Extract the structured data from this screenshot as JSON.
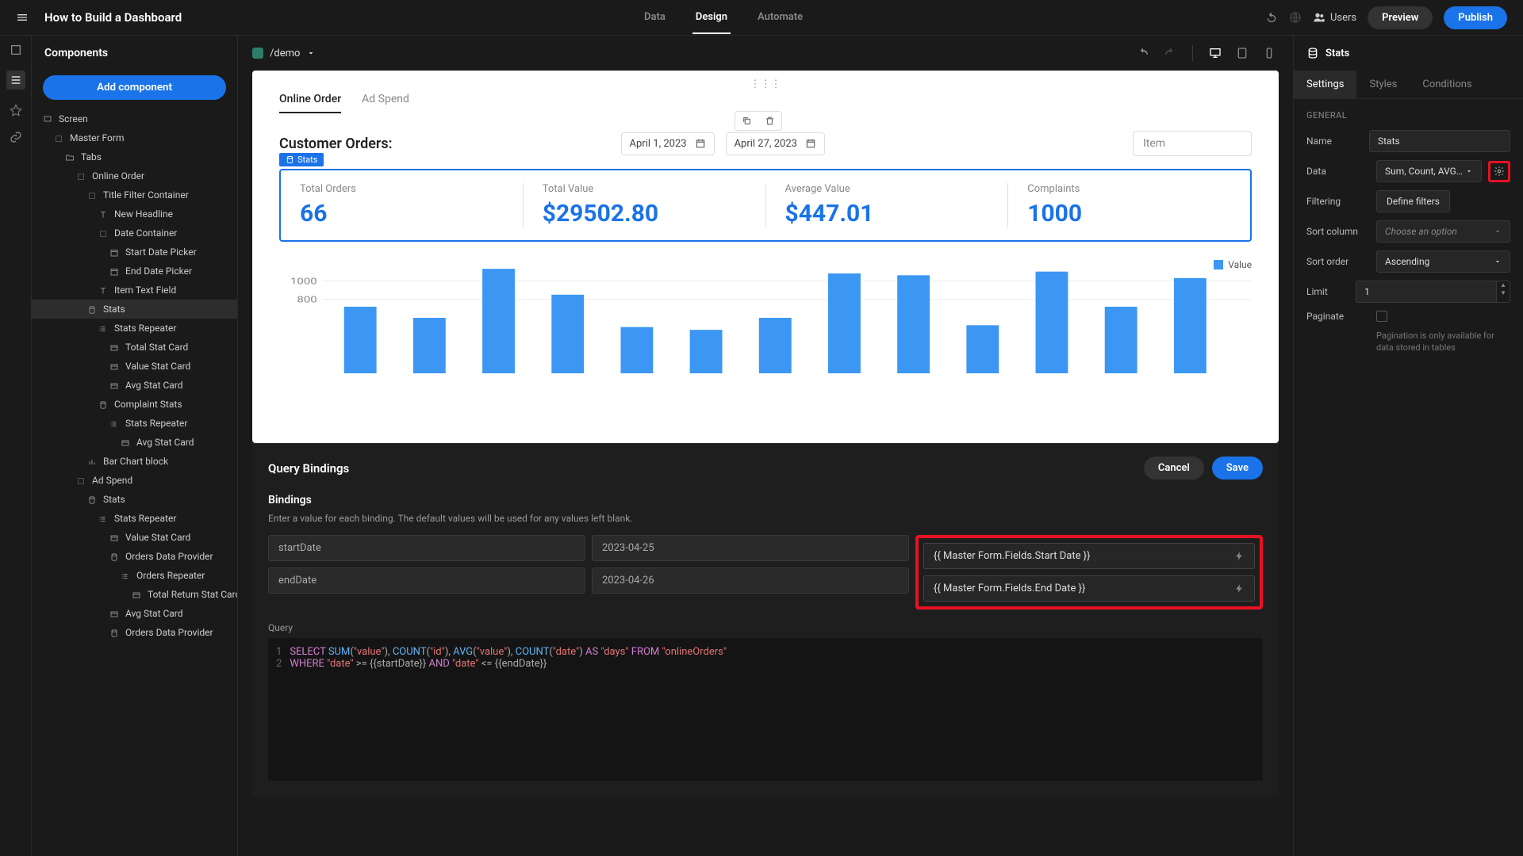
{
  "header": {
    "title": "How to Build a Dashboard",
    "tabs": [
      "Data",
      "Design",
      "Automate"
    ],
    "active_tab": "Design",
    "users_label": "Users",
    "preview_btn": "Preview",
    "publish_btn": "Publish"
  },
  "sidebar": {
    "title": "Components",
    "add_btn": "Add component",
    "tree": [
      {
        "icon": "screen",
        "label": "Screen",
        "indent": 0
      },
      {
        "icon": "box",
        "label": "Master Form",
        "indent": 1
      },
      {
        "icon": "folder",
        "label": "Tabs",
        "indent": 2
      },
      {
        "icon": "box",
        "label": "Online Order",
        "indent": 3
      },
      {
        "icon": "box",
        "label": "Title Filter Container",
        "indent": 4
      },
      {
        "icon": "text",
        "label": "New Headline",
        "indent": 5
      },
      {
        "icon": "box",
        "label": "Date Container",
        "indent": 5
      },
      {
        "icon": "date",
        "label": "Start Date Picker",
        "indent": 6
      },
      {
        "icon": "date",
        "label": "End Date Picker",
        "indent": 6
      },
      {
        "icon": "text",
        "label": "Item Text Field",
        "indent": 5
      },
      {
        "icon": "db",
        "label": "Stats",
        "indent": 4,
        "selected": true
      },
      {
        "icon": "repeat",
        "label": "Stats Repeater",
        "indent": 5
      },
      {
        "icon": "card",
        "label": "Total Stat Card",
        "indent": 6
      },
      {
        "icon": "card",
        "label": "Value Stat Card",
        "indent": 6
      },
      {
        "icon": "card",
        "label": "Avg Stat Card",
        "indent": 6
      },
      {
        "icon": "db",
        "label": "Complaint Stats",
        "indent": 5
      },
      {
        "icon": "repeat",
        "label": "Stats Repeater",
        "indent": 6
      },
      {
        "icon": "card",
        "label": "Avg Stat Card",
        "indent": 7
      },
      {
        "icon": "chart",
        "label": "Bar Chart block",
        "indent": 4
      },
      {
        "icon": "box",
        "label": "Ad Spend",
        "indent": 3
      },
      {
        "icon": "db",
        "label": "Stats",
        "indent": 4
      },
      {
        "icon": "repeat",
        "label": "Stats Repeater",
        "indent": 5
      },
      {
        "icon": "card",
        "label": "Value Stat Card",
        "indent": 6
      },
      {
        "icon": "db",
        "label": "Orders Data Provider",
        "indent": 6
      },
      {
        "icon": "repeat",
        "label": "Orders Repeater",
        "indent": 7
      },
      {
        "icon": "card",
        "label": "Total Return Stat Card",
        "indent": 8
      },
      {
        "icon": "card",
        "label": "Avg Stat Card",
        "indent": 6
      },
      {
        "icon": "db",
        "label": "Orders Data Provider",
        "indent": 6
      }
    ]
  },
  "canvas": {
    "path": "/demo",
    "preview": {
      "tabs": [
        "Online Order",
        "Ad Spend"
      ],
      "active_tab": "Online Order",
      "title": "Customer Orders:",
      "date1": "April 1, 2023",
      "date2": "April 27, 2023",
      "item_placeholder": "Item",
      "stats_label": "Stats",
      "stats": [
        {
          "label": "Total Orders",
          "value": "66"
        },
        {
          "label": "Total Value",
          "value": "$29502.80"
        },
        {
          "label": "Average Value",
          "value": "$447.01"
        },
        {
          "label": "Complaints",
          "value": "1000"
        }
      ],
      "legend": "Value",
      "y_ticks": [
        "1000",
        "800"
      ]
    }
  },
  "chart_data": {
    "type": "bar",
    "title": "",
    "xlabel": "",
    "ylabel": "Value",
    "ylim": [
      0,
      1200
    ],
    "series": [
      {
        "name": "Value",
        "values": [
          720,
          600,
          1130,
          850,
          500,
          470,
          600,
          1080,
          1060,
          520,
          1100,
          720,
          1030
        ]
      }
    ]
  },
  "query_bindings": {
    "title": "Query Bindings",
    "cancel": "Cancel",
    "save": "Save",
    "sub": "Bindings",
    "desc": "Enter a value for each binding. The default values will be used for any values left blank.",
    "rows": [
      {
        "name": "startDate",
        "default": "2023-04-25",
        "value": "{{ Master Form.Fields.Start Date }}"
      },
      {
        "name": "endDate",
        "default": "2023-04-26",
        "value": "{{ Master Form.Fields.End Date }}"
      }
    ],
    "query_label": "Query",
    "query_tokens": [
      {
        "ln": "1",
        "t": [
          [
            "kw",
            "SELECT"
          ],
          [
            "op",
            " "
          ],
          [
            "fn",
            "SUM"
          ],
          [
            "op",
            "("
          ],
          [
            "str",
            "\"value\""
          ],
          [
            "op",
            ")"
          ],
          [
            "op",
            ", "
          ],
          [
            "fn",
            "COUNT"
          ],
          [
            "op",
            "("
          ],
          [
            "str",
            "\"id\""
          ],
          [
            "op",
            ")"
          ],
          [
            "op",
            ", "
          ],
          [
            "fn",
            "AVG"
          ],
          [
            "op",
            "("
          ],
          [
            "str",
            "\"value\""
          ],
          [
            "op",
            ")"
          ],
          [
            "op",
            ", "
          ],
          [
            "fn",
            "COUNT"
          ],
          [
            "op",
            "("
          ],
          [
            "str",
            "\"date\""
          ],
          [
            "op",
            ") "
          ],
          [
            "kw",
            "AS"
          ],
          [
            "op",
            " "
          ],
          [
            "str",
            "\"days\""
          ],
          [
            "op",
            " "
          ],
          [
            "kw",
            "FROM"
          ],
          [
            "op",
            " "
          ],
          [
            "str",
            "\"onlineOrders\""
          ]
        ]
      },
      {
        "ln": "2",
        "t": [
          [
            "kw",
            "WHERE"
          ],
          [
            "op",
            " "
          ],
          [
            "str",
            "\"date\""
          ],
          [
            "op",
            " >= {{startDate}} "
          ],
          [
            "kw",
            "AND"
          ],
          [
            "op",
            " "
          ],
          [
            "str",
            "\"date\""
          ],
          [
            "op",
            " <= {{endDate}}"
          ]
        ]
      }
    ]
  },
  "rightpanel": {
    "title": "Stats",
    "tabs": [
      "Settings",
      "Styles",
      "Conditions"
    ],
    "active_tab": "Settings",
    "section": "GENERAL",
    "fields": {
      "name_label": "Name",
      "name_value": "Stats",
      "data_label": "Data",
      "data_value": "Sum, Count, AVG…",
      "filtering_label": "Filtering",
      "filtering_value": "Define filters",
      "sortcol_label": "Sort column",
      "sortcol_value": "Choose an option",
      "sortorder_label": "Sort order",
      "sortorder_value": "Ascending",
      "limit_label": "Limit",
      "limit_value": "1",
      "paginate_label": "Paginate",
      "paginate_hint": "Pagination is only available for data stored in tables"
    }
  }
}
